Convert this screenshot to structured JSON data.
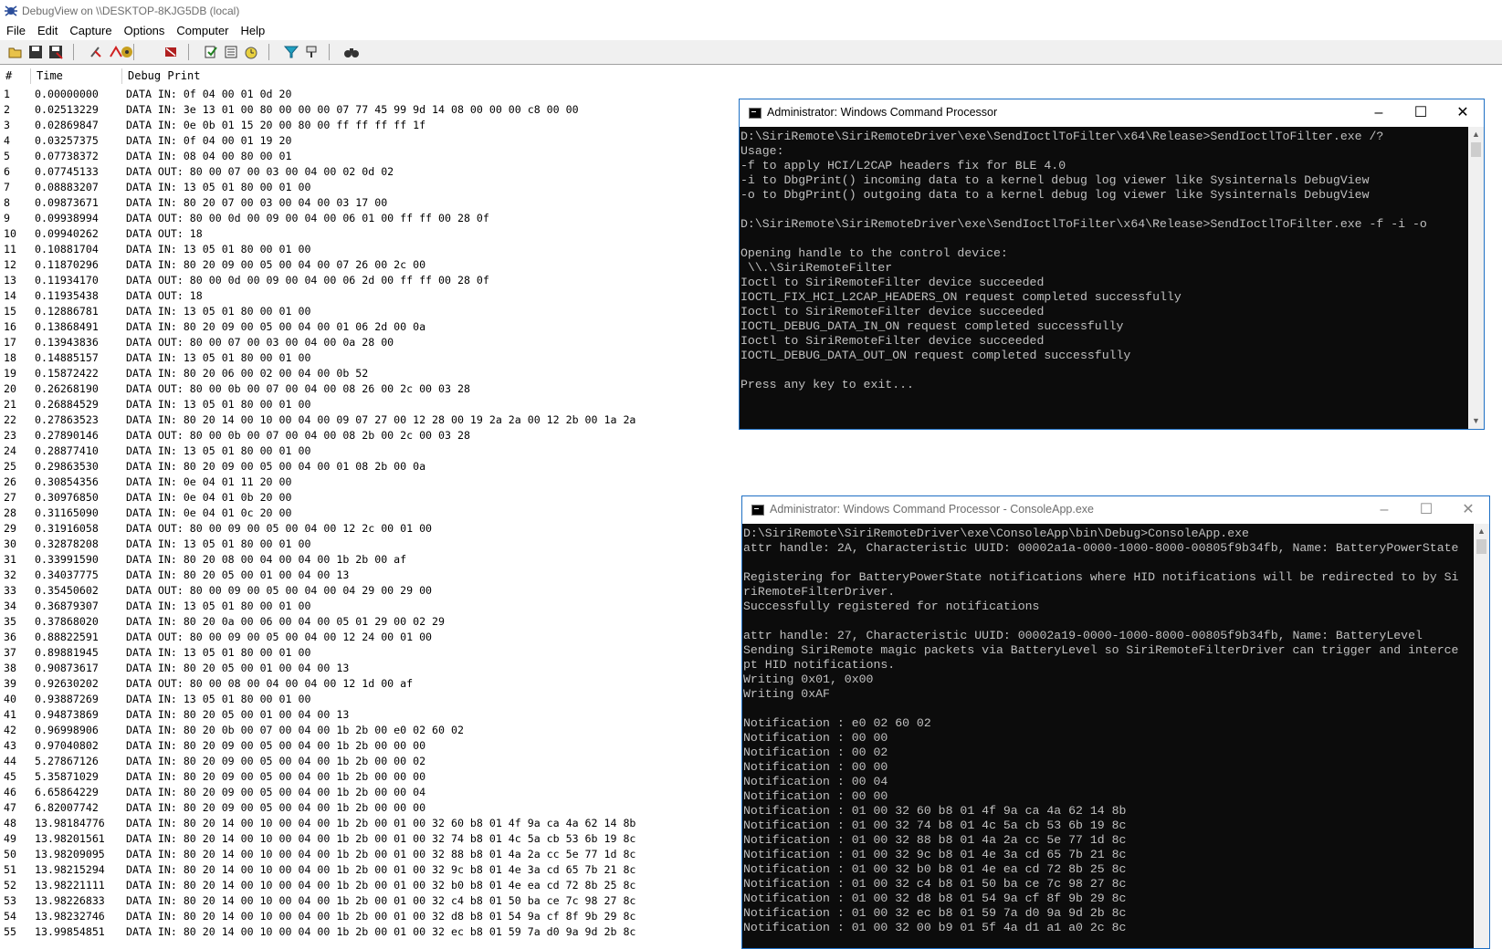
{
  "window": {
    "title": "DebugView on \\\\DESKTOP-8KJG5DB (local)"
  },
  "menu": [
    "File",
    "Edit",
    "Capture",
    "Options",
    "Computer",
    "Help"
  ],
  "toolbar": {
    "icons": [
      "open-icon",
      "save-icon",
      "save-as-icon",
      "clear-icon",
      "capture-icon",
      "autoscroll-icon",
      "capture-win32-icon",
      "capture-kernel-icon",
      "pass-through-icon",
      "filter-icon",
      "highlight-icon",
      "find-icon"
    ]
  },
  "columns": {
    "num": "#",
    "time": "Time",
    "print": "Debug Print"
  },
  "log": [
    [
      "1",
      "0.00000000",
      "DATA IN: 0f 04 00 01 0d 20"
    ],
    [
      "2",
      "0.02513229",
      "DATA IN: 3e 13 01 00 80 00 00 00 07 77 45 99 9d 14 08 00 00 00 c8 00 00"
    ],
    [
      "3",
      "0.02869847",
      "DATA IN: 0e 0b 01 15 20 00 80 00 ff ff ff ff 1f"
    ],
    [
      "4",
      "0.03257375",
      "DATA IN: 0f 04 00 01 19 20"
    ],
    [
      "5",
      "0.07738372",
      "DATA IN: 08 04 00 80 00 01"
    ],
    [
      "6",
      "0.07745133",
      "DATA OUT: 80 00 07 00 03 00 04 00 02 0d 02"
    ],
    [
      "7",
      "0.08883207",
      "DATA IN: 13 05 01 80 00 01 00"
    ],
    [
      "8",
      "0.09873671",
      "DATA IN: 80 20 07 00 03 00 04 00 03 17 00"
    ],
    [
      "9",
      "0.09938994",
      "DATA OUT: 80 00 0d 00 09 00 04 00 06 01 00 ff ff 00 28 0f"
    ],
    [
      "10",
      "0.09940262",
      "DATA OUT: 18"
    ],
    [
      "11",
      "0.10881704",
      "DATA IN: 13 05 01 80 00 01 00"
    ],
    [
      "12",
      "0.11870296",
      "DATA IN: 80 20 09 00 05 00 04 00 07 26 00 2c 00"
    ],
    [
      "13",
      "0.11934170",
      "DATA OUT: 80 00 0d 00 09 00 04 00 06 2d 00 ff ff 00 28 0f"
    ],
    [
      "14",
      "0.11935438",
      "DATA OUT: 18"
    ],
    [
      "15",
      "0.12886781",
      "DATA IN: 13 05 01 80 00 01 00"
    ],
    [
      "16",
      "0.13868491",
      "DATA IN: 80 20 09 00 05 00 04 00 01 06 2d 00 0a"
    ],
    [
      "17",
      "0.13943836",
      "DATA OUT: 80 00 07 00 03 00 04 00 0a 28 00"
    ],
    [
      "18",
      "0.14885157",
      "DATA IN: 13 05 01 80 00 01 00"
    ],
    [
      "19",
      "0.15872422",
      "DATA IN: 80 20 06 00 02 00 04 00 0b 52"
    ],
    [
      "20",
      "0.26268190",
      "DATA OUT: 80 00 0b 00 07 00 04 00 08 26 00 2c 00 03 28"
    ],
    [
      "21",
      "0.26884529",
      "DATA IN: 13 05 01 80 00 01 00"
    ],
    [
      "22",
      "0.27863523",
      "DATA IN: 80 20 14 00 10 00 04 00 09 07 27 00 12 28 00 19 2a 2a 00 12 2b 00 1a 2a"
    ],
    [
      "23",
      "0.27890146",
      "DATA OUT: 80 00 0b 00 07 00 04 00 08 2b 00 2c 00 03 28"
    ],
    [
      "24",
      "0.28877410",
      "DATA IN: 13 05 01 80 00 01 00"
    ],
    [
      "25",
      "0.29863530",
      "DATA IN: 80 20 09 00 05 00 04 00 01 08 2b 00 0a"
    ],
    [
      "26",
      "0.30854356",
      "DATA IN: 0e 04 01 11 20 00"
    ],
    [
      "27",
      "0.30976850",
      "DATA IN: 0e 04 01 0b 20 00"
    ],
    [
      "28",
      "0.31165090",
      "DATA IN: 0e 04 01 0c 20 00"
    ],
    [
      "29",
      "0.31916058",
      "DATA OUT: 80 00 09 00 05 00 04 00 12 2c 00 01 00"
    ],
    [
      "30",
      "0.32878208",
      "DATA IN: 13 05 01 80 00 01 00"
    ],
    [
      "31",
      "0.33991590",
      "DATA IN: 80 20 08 00 04 00 04 00 1b 2b 00 af"
    ],
    [
      "32",
      "0.34037775",
      "DATA IN: 80 20 05 00 01 00 04 00 13"
    ],
    [
      "33",
      "0.35450602",
      "DATA OUT: 80 00 09 00 05 00 04 00 04 29 00 29 00"
    ],
    [
      "34",
      "0.36879307",
      "DATA IN: 13 05 01 80 00 01 00"
    ],
    [
      "35",
      "0.37868020",
      "DATA IN: 80 20 0a 00 06 00 04 00 05 01 29 00 02 29"
    ],
    [
      "36",
      "0.88822591",
      "DATA OUT: 80 00 09 00 05 00 04 00 12 24 00 01 00"
    ],
    [
      "37",
      "0.89881945",
      "DATA IN: 13 05 01 80 00 01 00"
    ],
    [
      "38",
      "0.90873617",
      "DATA IN: 80 20 05 00 01 00 04 00 13"
    ],
    [
      "39",
      "0.92630202",
      "DATA OUT: 80 00 08 00 04 00 04 00 12 1d 00 af"
    ],
    [
      "40",
      "0.93887269",
      "DATA IN: 13 05 01 80 00 01 00"
    ],
    [
      "41",
      "0.94873869",
      "DATA IN: 80 20 05 00 01 00 04 00 13"
    ],
    [
      "42",
      "0.96998906",
      "DATA IN: 80 20 0b 00 07 00 04 00 1b 2b 00 e0 02 60 02"
    ],
    [
      "43",
      "0.97040802",
      "DATA IN: 80 20 09 00 05 00 04 00 1b 2b 00 00 00"
    ],
    [
      "44",
      "5.27867126",
      "DATA IN: 80 20 09 00 05 00 04 00 1b 2b 00 00 02"
    ],
    [
      "45",
      "5.35871029",
      "DATA IN: 80 20 09 00 05 00 04 00 1b 2b 00 00 00"
    ],
    [
      "46",
      "6.65864229",
      "DATA IN: 80 20 09 00 05 00 04 00 1b 2b 00 00 04"
    ],
    [
      "47",
      "6.82007742",
      "DATA IN: 80 20 09 00 05 00 04 00 1b 2b 00 00 00"
    ],
    [
      "48",
      "13.98184776",
      "DATA IN: 80 20 14 00 10 00 04 00 1b 2b 00 01 00 32 60 b8 01 4f 9a ca 4a 62 14 8b"
    ],
    [
      "49",
      "13.98201561",
      "DATA IN: 80 20 14 00 10 00 04 00 1b 2b 00 01 00 32 74 b8 01 4c 5a cb 53 6b 19 8c"
    ],
    [
      "50",
      "13.98209095",
      "DATA IN: 80 20 14 00 10 00 04 00 1b 2b 00 01 00 32 88 b8 01 4a 2a cc 5e 77 1d 8c"
    ],
    [
      "51",
      "13.98215294",
      "DATA IN: 80 20 14 00 10 00 04 00 1b 2b 00 01 00 32 9c b8 01 4e 3a cd 65 7b 21 8c"
    ],
    [
      "52",
      "13.98221111",
      "DATA IN: 80 20 14 00 10 00 04 00 1b 2b 00 01 00 32 b0 b8 01 4e ea cd 72 8b 25 8c"
    ],
    [
      "53",
      "13.98226833",
      "DATA IN: 80 20 14 00 10 00 04 00 1b 2b 00 01 00 32 c4 b8 01 50 ba ce 7c 98 27 8c"
    ],
    [
      "54",
      "13.98232746",
      "DATA IN: 80 20 14 00 10 00 04 00 1b 2b 00 01 00 32 d8 b8 01 54 9a cf 8f 9b 29 8c"
    ],
    [
      "55",
      "13.99854851",
      "DATA IN: 80 20 14 00 10 00 04 00 1b 2b 00 01 00 32 ec b8 01 59 7a d0 9a 9d 2b 8c"
    ]
  ],
  "cmd1": {
    "title": "Administrator: Windows Command Processor",
    "lines": [
      "D:\\SiriRemote\\SiriRemoteDriver\\exe\\SendIoctlToFilter\\x64\\Release>SendIoctlToFilter.exe /?",
      "Usage:",
      "-f to apply HCI/L2CAP headers fix for BLE 4.0",
      "-i to DbgPrint() incoming data to a kernel debug log viewer like Sysinternals DebugView",
      "-o to DbgPrint() outgoing data to a kernel debug log viewer like Sysinternals DebugView",
      "",
      "D:\\SiriRemote\\SiriRemoteDriver\\exe\\SendIoctlToFilter\\x64\\Release>SendIoctlToFilter.exe -f -i -o",
      "",
      "Opening handle to the control device:",
      " \\\\.\\SiriRemoteFilter",
      "Ioctl to SiriRemoteFilter device succeeded",
      "IOCTL_FIX_HCI_L2CAP_HEADERS_ON request completed successfully",
      "Ioctl to SiriRemoteFilter device succeeded",
      "IOCTL_DEBUG_DATA_IN_ON request completed successfully",
      "Ioctl to SiriRemoteFilter device succeeded",
      "IOCTL_DEBUG_DATA_OUT_ON request completed successfully",
      "",
      "Press any key to exit..."
    ]
  },
  "cmd2": {
    "title": "Administrator: Windows Command Processor - ConsoleApp.exe",
    "lines": [
      "D:\\SiriRemote\\SiriRemoteDriver\\exe\\ConsoleApp\\bin\\Debug>ConsoleApp.exe",
      "attr handle: 2A, Characteristic UUID: 00002a1a-0000-1000-8000-00805f9b34fb, Name: BatteryPowerState",
      "",
      "Registering for BatteryPowerState notifications where HID notifications will be redirected to by Si",
      "riRemoteFilterDriver.",
      "Successfully registered for notifications",
      "",
      "attr handle: 27, Characteristic UUID: 00002a19-0000-1000-8000-00805f9b34fb, Name: BatteryLevel",
      "Sending SiriRemote magic packets via BatteryLevel so SiriRemoteFilterDriver can trigger and interce",
      "pt HID notifications.",
      "Writing 0x01, 0x00",
      "Writing 0xAF",
      "",
      "Notification : e0 02 60 02",
      "Notification : 00 00",
      "Notification : 00 02",
      "Notification : 00 00",
      "Notification : 00 04",
      "Notification : 00 00",
      "Notification : 01 00 32 60 b8 01 4f 9a ca 4a 62 14 8b",
      "Notification : 01 00 32 74 b8 01 4c 5a cb 53 6b 19 8c",
      "Notification : 01 00 32 88 b8 01 4a 2a cc 5e 77 1d 8c",
      "Notification : 01 00 32 9c b8 01 4e 3a cd 65 7b 21 8c",
      "Notification : 01 00 32 b0 b8 01 4e ea cd 72 8b 25 8c",
      "Notification : 01 00 32 c4 b8 01 50 ba ce 7c 98 27 8c",
      "Notification : 01 00 32 d8 b8 01 54 9a cf 8f 9b 29 8c",
      "Notification : 01 00 32 ec b8 01 59 7a d0 9a 9d 2b 8c",
      "Notification : 01 00 32 00 b9 01 5f 4a d1 a1 a0 2c 8c"
    ]
  }
}
